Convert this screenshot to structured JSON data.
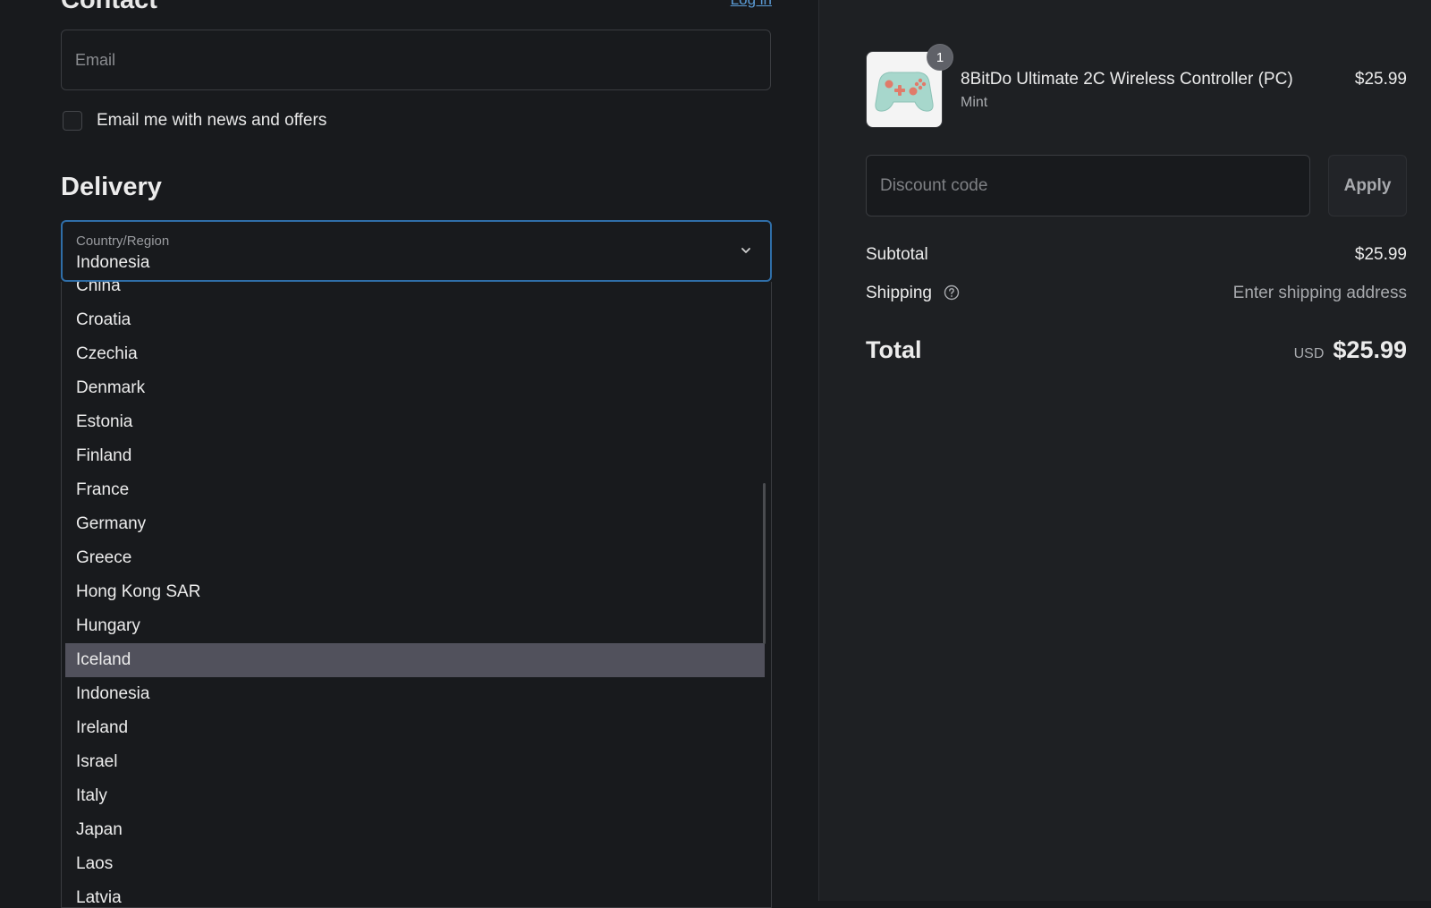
{
  "contact": {
    "title": "Contact",
    "login_label": "Log in",
    "email_placeholder": "Email",
    "newsletter_label": "Email me with news and offers"
  },
  "delivery": {
    "title": "Delivery",
    "country_label": "Country/Region",
    "country_value": "Indonesia",
    "options": [
      "China",
      "Croatia",
      "Czechia",
      "Denmark",
      "Estonia",
      "Finland",
      "France",
      "Germany",
      "Greece",
      "Hong Kong SAR",
      "Hungary",
      "Iceland",
      "Indonesia",
      "Ireland",
      "Israel",
      "Italy",
      "Japan",
      "Laos",
      "Latvia"
    ],
    "highlighted_option": "Iceland"
  },
  "summary": {
    "product": {
      "name": "8BitDo Ultimate 2C Wireless Controller (PC)",
      "variant": "Mint",
      "price": "$25.99",
      "quantity": "1"
    },
    "discount_placeholder": "Discount code",
    "apply_label": "Apply",
    "subtotal_label": "Subtotal",
    "subtotal_value": "$25.99",
    "shipping_label": "Shipping",
    "shipping_value": "Enter shipping address",
    "total_label": "Total",
    "currency": "USD",
    "total_value": "$25.99"
  },
  "colors": {
    "accent_border": "#2f6ea8",
    "highlight_bg": "#51515c",
    "link": "#5b9bd5"
  },
  "icons": [
    "chevron-down-icon",
    "help-circle-icon",
    "controller-image"
  ]
}
